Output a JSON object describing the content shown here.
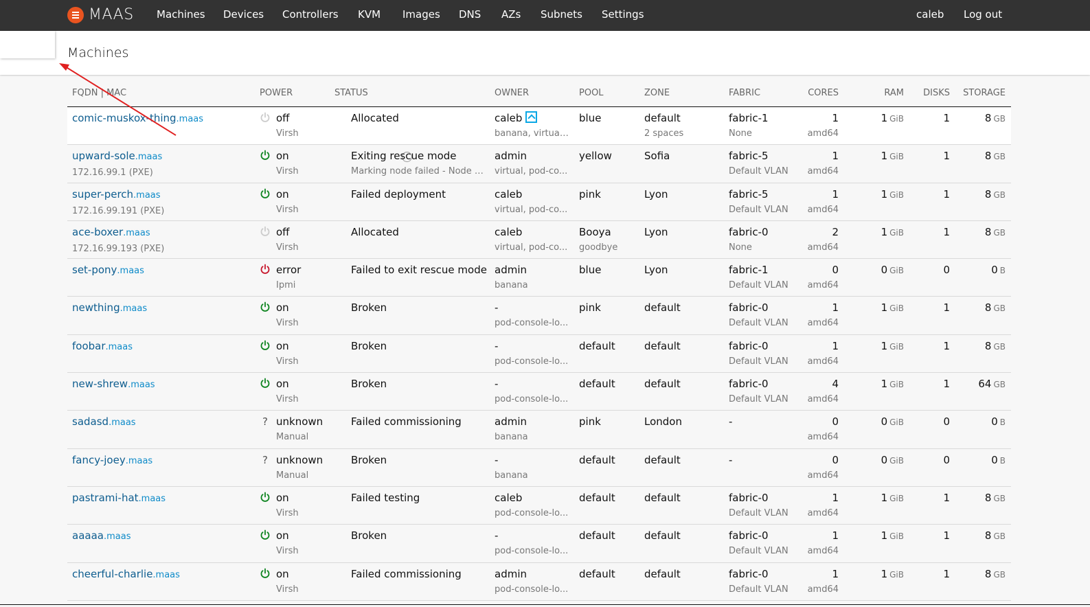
{
  "nav": {
    "brand": "MAAS",
    "links": [
      "Machines",
      "Devices",
      "Controllers",
      "KVM",
      "Images",
      "DNS",
      "AZs",
      "Subnets",
      "Settings"
    ],
    "user": "caleb",
    "logout": "Log out"
  },
  "page": {
    "title": "Machines"
  },
  "table": {
    "headers": [
      "FQDN | MAC",
      "POWER",
      "STATUS",
      "OWNER",
      "POOL",
      "ZONE",
      "FABRIC",
      "CORES",
      "RAM",
      "DISKS",
      "STORAGE"
    ],
    "rows": [
      {
        "host": "comic-muskox-thing",
        "domain": ".maas",
        "sub": "",
        "power": "off",
        "powerState": "off",
        "powerType": "Virsh",
        "status": "Allocated",
        "statusSub": "",
        "owner": "caleb",
        "ownerSub": "banana, virtual...",
        "ownerBadge": true,
        "pool": "blue",
        "poolSub": "",
        "zone": "default",
        "zoneSub": "2 spaces",
        "fabric": "fabric-1",
        "fabricSub": "None",
        "cores": "1",
        "arch": "amd64",
        "ram": "1",
        "ramUnit": "GiB",
        "disks": "1",
        "storage": "8",
        "storageUnit": "GB",
        "spinner": false
      },
      {
        "host": "upward-sole",
        "domain": ".maas",
        "sub": "172.16.99.1 (PXE)",
        "power": "on",
        "powerState": "on",
        "powerType": "Virsh",
        "status": "Exiting rescue mode",
        "statusSub": "Marking node failed - Node o...",
        "owner": "admin",
        "ownerSub": "virtual, pod-co...",
        "ownerBadge": false,
        "pool": "yellow",
        "poolSub": "",
        "zone": "Sofia",
        "zoneSub": "",
        "fabric": "fabric-5",
        "fabricSub": "Default VLAN",
        "cores": "1",
        "arch": "amd64",
        "ram": "1",
        "ramUnit": "GiB",
        "disks": "1",
        "storage": "8",
        "storageUnit": "GB",
        "spinner": true
      },
      {
        "host": "super-perch",
        "domain": ".maas",
        "sub": "172.16.99.191 (PXE)",
        "power": "on",
        "powerState": "on",
        "powerType": "Virsh",
        "status": "Failed deployment",
        "statusSub": "",
        "owner": "caleb",
        "ownerSub": "virtual, pod-co...",
        "ownerBadge": false,
        "pool": "pink",
        "poolSub": "",
        "zone": "Lyon",
        "zoneSub": "",
        "fabric": "fabric-5",
        "fabricSub": "Default VLAN",
        "cores": "1",
        "arch": "amd64",
        "ram": "1",
        "ramUnit": "GiB",
        "disks": "1",
        "storage": "8",
        "storageUnit": "GB",
        "spinner": false
      },
      {
        "host": "ace-boxer",
        "domain": ".maas",
        "sub": "172.16.99.193 (PXE)",
        "power": "off",
        "powerState": "off",
        "powerType": "Virsh",
        "status": "Allocated",
        "statusSub": "",
        "owner": "caleb",
        "ownerSub": "virtual, pod-co...",
        "ownerBadge": false,
        "pool": "Booya",
        "poolSub": "goodbye",
        "zone": "Lyon",
        "zoneSub": "",
        "fabric": "fabric-0",
        "fabricSub": "None",
        "cores": "2",
        "arch": "amd64",
        "ram": "1",
        "ramUnit": "GiB",
        "disks": "1",
        "storage": "8",
        "storageUnit": "GB",
        "spinner": false
      },
      {
        "host": "set-pony",
        "domain": ".maas",
        "sub": "",
        "power": "error",
        "powerState": "error",
        "powerType": "Ipmi",
        "status": "Failed to exit rescue mode",
        "statusSub": "",
        "owner": "admin",
        "ownerSub": "banana",
        "ownerBadge": false,
        "pool": "blue",
        "poolSub": "",
        "zone": "Lyon",
        "zoneSub": "",
        "fabric": "fabric-1",
        "fabricSub": "Default VLAN",
        "cores": "0",
        "arch": "amd64",
        "ram": "0",
        "ramUnit": "GiB",
        "disks": "0",
        "storage": "0",
        "storageUnit": "B",
        "spinner": false
      },
      {
        "host": "newthing",
        "domain": ".maas",
        "sub": "",
        "power": "on",
        "powerState": "on",
        "powerType": "Virsh",
        "status": "Broken",
        "statusSub": "",
        "owner": "-",
        "ownerSub": "pod-console-lo...",
        "ownerBadge": false,
        "pool": "pink",
        "poolSub": "",
        "zone": "default",
        "zoneSub": "",
        "fabric": "fabric-0",
        "fabricSub": "Default VLAN",
        "cores": "1",
        "arch": "amd64",
        "ram": "1",
        "ramUnit": "GiB",
        "disks": "1",
        "storage": "8",
        "storageUnit": "GB",
        "spinner": false
      },
      {
        "host": "foobar",
        "domain": ".maas",
        "sub": "",
        "power": "on",
        "powerState": "on",
        "powerType": "Virsh",
        "status": "Broken",
        "statusSub": "",
        "owner": "-",
        "ownerSub": "pod-console-lo...",
        "ownerBadge": false,
        "pool": "default",
        "poolSub": "",
        "zone": "default",
        "zoneSub": "",
        "fabric": "fabric-0",
        "fabricSub": "Default VLAN",
        "cores": "1",
        "arch": "amd64",
        "ram": "1",
        "ramUnit": "GiB",
        "disks": "1",
        "storage": "8",
        "storageUnit": "GB",
        "spinner": false
      },
      {
        "host": "new-shrew",
        "domain": ".maas",
        "sub": "",
        "power": "on",
        "powerState": "on",
        "powerType": "Virsh",
        "status": "Broken",
        "statusSub": "",
        "owner": "-",
        "ownerSub": "pod-console-lo...",
        "ownerBadge": false,
        "pool": "default",
        "poolSub": "",
        "zone": "default",
        "zoneSub": "",
        "fabric": "fabric-0",
        "fabricSub": "Default VLAN",
        "cores": "4",
        "arch": "amd64",
        "ram": "1",
        "ramUnit": "GiB",
        "disks": "1",
        "storage": "64",
        "storageUnit": "GB",
        "spinner": false
      },
      {
        "host": "sadasd",
        "domain": ".maas",
        "sub": "",
        "power": "unknown",
        "powerState": "unknown",
        "powerType": "Manual",
        "status": "Failed commissioning",
        "statusSub": "",
        "owner": "admin",
        "ownerSub": "banana",
        "ownerBadge": false,
        "pool": "pink",
        "poolSub": "",
        "zone": "London",
        "zoneSub": "",
        "fabric": "-",
        "fabricSub": "",
        "cores": "0",
        "arch": "amd64",
        "ram": "0",
        "ramUnit": "GiB",
        "disks": "0",
        "storage": "0",
        "storageUnit": "B",
        "spinner": false
      },
      {
        "host": "fancy-joey",
        "domain": ".maas",
        "sub": "",
        "power": "unknown",
        "powerState": "unknown",
        "powerType": "Manual",
        "status": "Broken",
        "statusSub": "",
        "owner": "-",
        "ownerSub": "banana",
        "ownerBadge": false,
        "pool": "default",
        "poolSub": "",
        "zone": "default",
        "zoneSub": "",
        "fabric": "-",
        "fabricSub": "",
        "cores": "0",
        "arch": "amd64",
        "ram": "0",
        "ramUnit": "GiB",
        "disks": "0",
        "storage": "0",
        "storageUnit": "B",
        "spinner": false
      },
      {
        "host": "pastrami-hat",
        "domain": ".maas",
        "sub": "",
        "power": "on",
        "powerState": "on",
        "powerType": "Virsh",
        "status": "Failed testing",
        "statusSub": "",
        "owner": "caleb",
        "ownerSub": "pod-console-lo...",
        "ownerBadge": false,
        "pool": "default",
        "poolSub": "",
        "zone": "default",
        "zoneSub": "",
        "fabric": "fabric-0",
        "fabricSub": "Default VLAN",
        "cores": "1",
        "arch": "amd64",
        "ram": "1",
        "ramUnit": "GiB",
        "disks": "1",
        "storage": "8",
        "storageUnit": "GB",
        "spinner": false
      },
      {
        "host": "aaaaa",
        "domain": ".maas",
        "sub": "",
        "power": "on",
        "powerState": "on",
        "powerType": "Virsh",
        "status": "Broken",
        "statusSub": "",
        "owner": "-",
        "ownerSub": "pod-console-lo...",
        "ownerBadge": false,
        "pool": "default",
        "poolSub": "",
        "zone": "default",
        "zoneSub": "",
        "fabric": "fabric-0",
        "fabricSub": "Default VLAN",
        "cores": "1",
        "arch": "amd64",
        "ram": "1",
        "ramUnit": "GiB",
        "disks": "1",
        "storage": "8",
        "storageUnit": "GB",
        "spinner": false
      },
      {
        "host": "cheerful-charlie",
        "domain": ".maas",
        "sub": "",
        "power": "on",
        "powerState": "on",
        "powerType": "Virsh",
        "status": "Failed commissioning",
        "statusSub": "",
        "owner": "admin",
        "ownerSub": "pod-console-lo...",
        "ownerBadge": false,
        "pool": "default",
        "poolSub": "",
        "zone": "default",
        "zoneSub": "",
        "fabric": "fabric-0",
        "fabricSub": "Default VLAN",
        "cores": "1",
        "arch": "amd64",
        "ram": "1",
        "ramUnit": "GiB",
        "disks": "1",
        "storage": "8",
        "storageUnit": "GB",
        "spinner": false
      }
    ]
  },
  "colors": {
    "nav_bg": "#333333",
    "brand": "#e95420",
    "link": "#0e5d8f",
    "power_on": "#0e8420",
    "power_off": "#cccccc",
    "power_error": "#c7162b",
    "annotation": "#e02020"
  },
  "icons": {
    "logo": "maas-logo-icon",
    "power": "power-icon",
    "unknown": "question-icon",
    "spinner": "spinner-icon",
    "owner_badge": "owner-badge-icon"
  }
}
